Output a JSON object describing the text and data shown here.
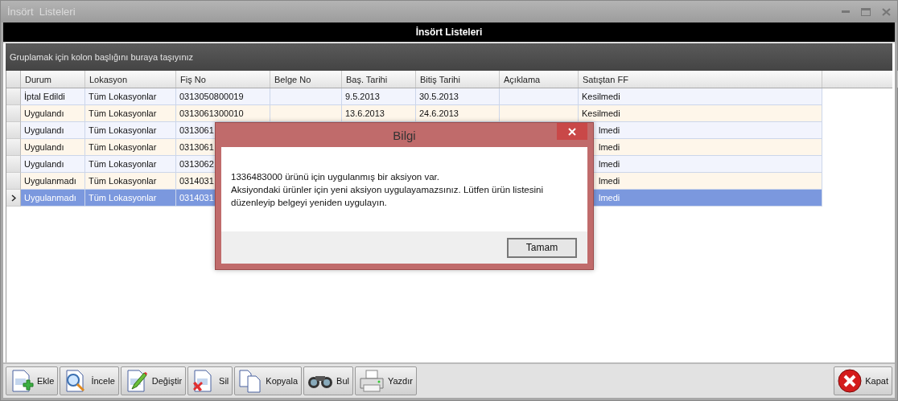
{
  "window": {
    "title": "İnsört  Listeleri"
  },
  "header": {
    "title": "İnsört Listeleri"
  },
  "group_panel": {
    "text": "Gruplamak için kolon başlığını buraya taşıyınız"
  },
  "table": {
    "columns": [
      "Durum",
      "Lokasyon",
      "Fiş No",
      "Belge No",
      "Baş. Tarihi",
      "Bitiş Tarihi",
      "Açıklama",
      "Satıştan FF"
    ],
    "rows": [
      {
        "selected": false,
        "cells": [
          "İptal Edildi",
          "Tüm Lokasyonlar",
          "0313050800019",
          "",
          "9.5.2013",
          "30.5.2013",
          "",
          "Kesilmedi"
        ]
      },
      {
        "selected": false,
        "cells": [
          "Uygulandı",
          "Tüm Lokasyonlar",
          "0313061300010",
          "",
          "13.6.2013",
          "24.6.2013",
          "",
          "Kesilmedi"
        ]
      },
      {
        "selected": false,
        "under_dialog": true,
        "cells": [
          "Uygulandı",
          "Tüm Lokasyonlar",
          "0313061",
          "",
          "",
          "",
          "",
          "lmedi"
        ]
      },
      {
        "selected": false,
        "under_dialog": true,
        "cells": [
          "Uygulandı",
          "Tüm Lokasyonlar",
          "0313061",
          "",
          "",
          "",
          "",
          "lmedi"
        ]
      },
      {
        "selected": false,
        "under_dialog": true,
        "cells": [
          "Uygulandı",
          "Tüm Lokasyonlar",
          "0313062",
          "",
          "",
          "",
          "",
          "lmedi"
        ]
      },
      {
        "selected": false,
        "under_dialog": true,
        "cells": [
          "Uygulanmadı",
          "Tüm Lokasyonlar",
          "0314031",
          "",
          "",
          "",
          "",
          "lmedi"
        ]
      },
      {
        "selected": true,
        "under_dialog": true,
        "cells": [
          "Uygulanmadı",
          "Tüm Lokasyonlar",
          "0314031",
          "",
          "",
          "",
          "",
          "lmedi"
        ]
      }
    ]
  },
  "dialog": {
    "title": "Bilgi",
    "lines": [
      "1336483000 ürünü için uygulanmış bir aksiyon var.",
      "Aksiyondaki ürünler için yeni aksiyon uygulayamazsınız. Lütfen ürün listesini",
      "düzenleyip belgeyi yeniden uygulayın."
    ],
    "button": "Tamam"
  },
  "toolbar": {
    "buttons": [
      {
        "kind": "add",
        "label": "Ekle"
      },
      {
        "kind": "inspect",
        "label": "İncele"
      },
      {
        "kind": "edit",
        "label": "Değiştir"
      },
      {
        "kind": "delete",
        "label": "Sil"
      },
      {
        "kind": "copy",
        "label": "Kopyala"
      },
      {
        "kind": "find",
        "label": "Bul"
      },
      {
        "kind": "print",
        "label": "Yazdır"
      }
    ],
    "close": "Kapat"
  }
}
